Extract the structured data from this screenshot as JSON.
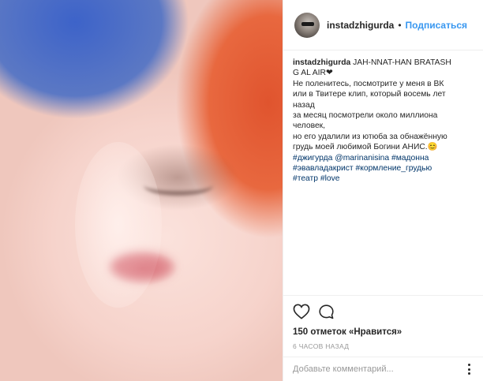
{
  "post": {
    "username": "instadzhigurda",
    "follow_label": "Подписаться",
    "separator": "•"
  },
  "caption": {
    "user": "instadzhigurda",
    "title_a": "JAH-NNAT-HAN BRATASH",
    "title_b": "G AL AIR❤",
    "lines": [
      "Не поленитесь, посмотрите у меня в ВК",
      "или в Твитере клип, который восемь лет",
      "назад",
      "за месяц посмотрели около миллиона",
      "человек,",
      "но его удалили из ютюба за обнажённую",
      "грудь моей любимой Богини АНИС.😊"
    ],
    "tags_line1": [
      "#джигурда",
      "@marinanisina",
      "#мадонна"
    ],
    "tags_line2": [
      "#эвавладакрист",
      "#кормление_грудью"
    ],
    "tags_line3": [
      "#театр",
      "#love"
    ]
  },
  "actions": {
    "like_icon": "heart-icon",
    "comment_icon": "speech-bubble-icon",
    "likes_text": "150 отметок «Нравится»",
    "time_text": "6 часов назад"
  },
  "comment": {
    "placeholder": "Добавьте комментарий...",
    "more_icon": "more-dots-icon"
  },
  "colors": {
    "link": "#003569",
    "follow": "#3897f0",
    "muted": "#999999",
    "text": "#262626"
  }
}
